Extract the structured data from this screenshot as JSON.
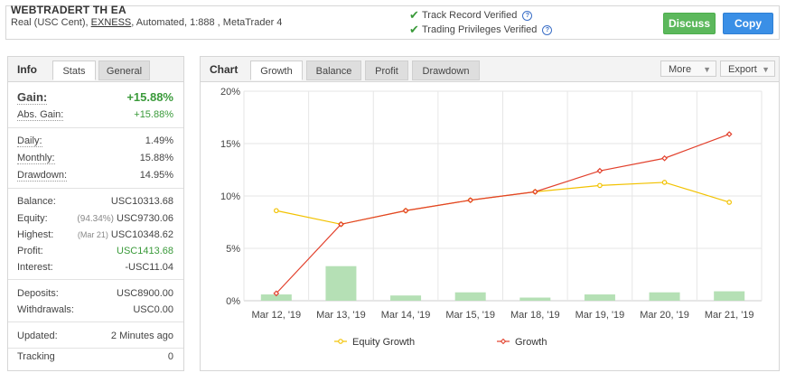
{
  "header": {
    "title": "WEBTRADERT TH EA",
    "account_prefix": "Real (USC Cent),",
    "broker": "EXNESS",
    "account_suffix": ", Automated, 1:888 , MetaTrader 4",
    "verified_track": "Track Record Verified",
    "verified_privileges": "Trading Privileges Verified",
    "discuss_label": "Discuss",
    "copy_label": "Copy"
  },
  "info": {
    "title": "Info",
    "tabs": [
      "Stats",
      "General"
    ],
    "gain_label": "Gain:",
    "gain_value": "+15.88%",
    "abs_gain_label": "Abs. Gain:",
    "abs_gain_value": "+15.88%",
    "daily_label": "Daily:",
    "daily_value": "1.49%",
    "monthly_label": "Monthly:",
    "monthly_value": "15.88%",
    "drawdown_label": "Drawdown:",
    "drawdown_value": "14.95%",
    "balance_label": "Balance:",
    "balance_value": "USC10313.68",
    "equity_label": "Equity:",
    "equity_pct": "(94.34%)",
    "equity_value": "USC9730.06",
    "highest_label": "Highest:",
    "highest_date": "(Mar 21)",
    "highest_value": "USC10348.62",
    "profit_label": "Profit:",
    "profit_value": "USC1413.68",
    "interest_label": "Interest:",
    "interest_value": "-USC11.04",
    "deposits_label": "Deposits:",
    "deposits_value": "USC8900.00",
    "withdrawals_label": "Withdrawals:",
    "withdrawals_value": "USC0.00",
    "updated_label": "Updated:",
    "updated_value": "2 Minutes ago",
    "tracking_label": "Tracking",
    "tracking_value": "0"
  },
  "chart_panel": {
    "title": "Chart",
    "tabs": [
      "Growth",
      "Balance",
      "Profit",
      "Drawdown"
    ],
    "more_label": "More",
    "export_label": "Export"
  },
  "chart_data": {
    "type": "line",
    "categories": [
      "Mar 12, '19",
      "Mar 13, '19",
      "Mar 14, '19",
      "Mar 15, '19",
      "Mar 18, '19",
      "Mar 19, '19",
      "Mar 20, '19",
      "Mar 21, '19"
    ],
    "y_ticks": [
      "0%",
      "5%",
      "10%",
      "15%",
      "20%"
    ],
    "ylim": [
      0,
      20
    ],
    "series": [
      {
        "name": "Equity Growth",
        "type": "line",
        "color": "#f2c200",
        "values": [
          8.6,
          7.3,
          8.6,
          9.6,
          10.4,
          11.0,
          11.3,
          9.4
        ]
      },
      {
        "name": "Growth",
        "type": "line",
        "color": "#e2402c",
        "values": [
          0.7,
          7.3,
          8.6,
          9.6,
          10.4,
          12.4,
          13.6,
          15.9
        ]
      },
      {
        "type": "bar",
        "color": "#b5e0b5",
        "values": [
          0.6,
          3.3,
          0.5,
          0.8,
          0.3,
          0.6,
          0.8,
          0.9
        ]
      }
    ],
    "legend_position": "bottom",
    "grid": true
  }
}
